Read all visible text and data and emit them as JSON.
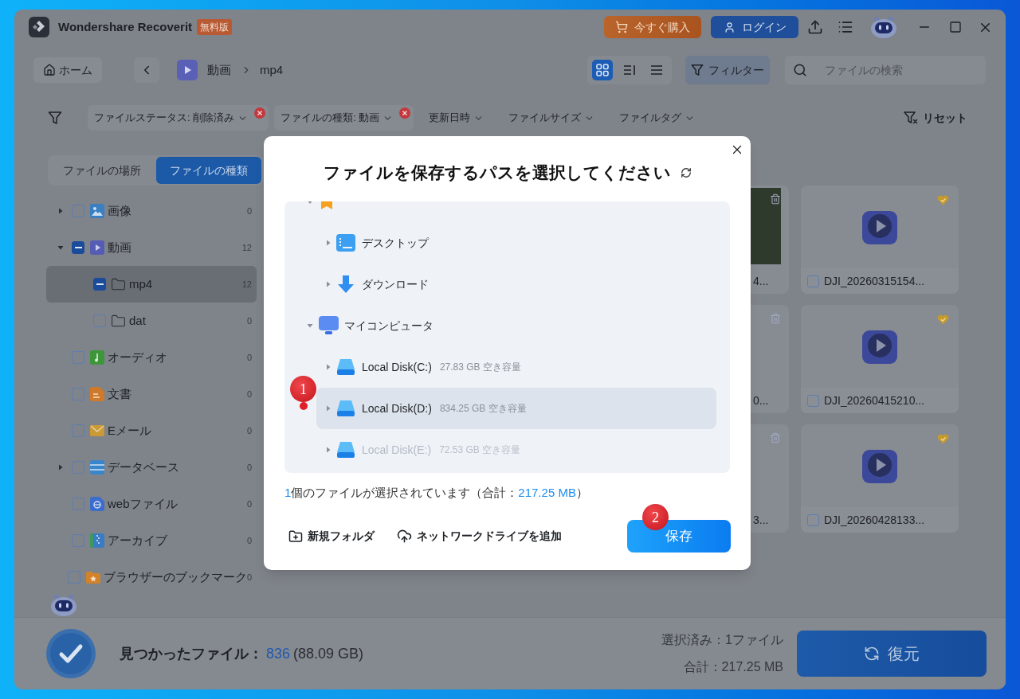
{
  "window": {
    "app_name": "Wondershare Recoverit",
    "edition_badge": "無料版",
    "buy_button": "今すぐ購入",
    "login_button": "ログイン"
  },
  "toolbar": {
    "home_button": "ホーム",
    "breadcrumb": [
      {
        "label": "動画"
      },
      {
        "label": "mp4"
      }
    ],
    "view_modes": [
      {
        "kind": "grid",
        "selected": true
      },
      {
        "kind": "detail",
        "selected": false
      },
      {
        "kind": "list",
        "selected": false
      }
    ],
    "filter_button": {
      "label": "フィルター",
      "active": true
    },
    "search": {
      "placeholder": "ファイルの検索"
    }
  },
  "filters": {
    "items": [
      {
        "label": "ファイルステータス: 削除済み",
        "active": true
      },
      {
        "label": "ファイルの種類: 動画",
        "active": true
      },
      {
        "label": "更新日時",
        "active": false
      },
      {
        "label": "ファイルサイズ",
        "active": false
      },
      {
        "label": "ファイルタグ",
        "active": false
      }
    ],
    "reset": "リセット"
  },
  "sidebar": {
    "tabs": [
      {
        "label": "ファイルの場所",
        "selected": false
      },
      {
        "label": "ファイルの種類",
        "selected": true
      }
    ],
    "categories": [
      {
        "label": "画像",
        "count": "0",
        "kind": "image",
        "expandable": true,
        "expanded": false,
        "checked": false,
        "indeterminate": false,
        "selected": false
      },
      {
        "label": "動画",
        "count": "12",
        "kind": "video",
        "expandable": true,
        "expanded": true,
        "checked": true,
        "indeterminate": true,
        "selected": false,
        "children": [
          {
            "label": "mp4",
            "count": "12",
            "kind": "folder",
            "expandable": false,
            "expanded": false,
            "checked": true,
            "indeterminate": true,
            "selected": true
          },
          {
            "label": "dat",
            "count": "0",
            "kind": "folder",
            "expandable": false,
            "expanded": false,
            "checked": false,
            "indeterminate": false,
            "selected": false
          }
        ]
      },
      {
        "label": "オーディオ",
        "count": "0",
        "kind": "audio",
        "expandable": false,
        "expanded": false,
        "checked": false,
        "indeterminate": false,
        "selected": false
      },
      {
        "label": "文書",
        "count": "0",
        "kind": "document",
        "expandable": false,
        "expanded": false,
        "checked": false,
        "indeterminate": false,
        "selected": false
      },
      {
        "label": "Eメール",
        "count": "0",
        "kind": "email",
        "expandable": false,
        "expanded": false,
        "checked": false,
        "indeterminate": false,
        "selected": false
      },
      {
        "label": "データベース",
        "count": "0",
        "kind": "database",
        "expandable": true,
        "expanded": false,
        "checked": false,
        "indeterminate": false,
        "selected": false
      },
      {
        "label": "webファイル",
        "count": "0",
        "kind": "web",
        "expandable": false,
        "expanded": false,
        "checked": false,
        "indeterminate": false,
        "selected": false
      },
      {
        "label": "アーカイブ",
        "count": "0",
        "kind": "archive",
        "expandable": false,
        "expanded": false,
        "checked": false,
        "indeterminate": false,
        "selected": false
      },
      {
        "label": "ブラウザーのブックマーク",
        "count": "0",
        "kind": "bookmark",
        "expandable": false,
        "expanded": false,
        "checked": false,
        "indeterminate": false,
        "selected": false
      }
    ]
  },
  "file_grid": {
    "rows": [
      {
        "covered_card": {
          "name": "4...",
          "kind": "photo",
          "deleted": true,
          "favorite": false
        },
        "card": {
          "name": "DJI_20260315154...",
          "kind": "video",
          "deleted": false,
          "favorite": true,
          "checked": false
        }
      },
      {
        "covered_card": {
          "name": "0...",
          "kind": "video",
          "deleted": true,
          "favorite": false
        },
        "card": {
          "name": "DJI_20260415210...",
          "kind": "video",
          "deleted": false,
          "favorite": true,
          "checked": false
        }
      },
      {
        "covered_card": {
          "name": "3...",
          "kind": "video",
          "deleted": true,
          "favorite": false
        },
        "card": {
          "name": "DJI_20260428133...",
          "kind": "video",
          "deleted": false,
          "favorite": true,
          "checked": false
        }
      }
    ]
  },
  "save_dialog": {
    "title": "ファイルを保存するパスを選択してください",
    "tree": [
      {
        "kind": "bookmark",
        "expanded": true,
        "selected": false,
        "children": [
          {
            "label": "デスクトップ",
            "kind": "desktop",
            "expanded": false,
            "selected": false
          },
          {
            "label": "ダウンロード",
            "kind": "download",
            "expanded": false,
            "selected": false
          }
        ]
      },
      {
        "label": "マイコンピュータ",
        "kind": "computer",
        "expanded": true,
        "selected": false,
        "children": [
          {
            "label": "Local Disk(C:)",
            "free_space": "27.83 GB 空き容量",
            "kind": "disk",
            "expanded": false,
            "selected": false,
            "disabled": false
          },
          {
            "label": "Local Disk(D:)",
            "free_space": "834.25 GB 空き容量",
            "kind": "disk",
            "expanded": false,
            "selected": true,
            "disabled": false
          },
          {
            "label": "Local Disk(E:)",
            "free_space": "72.53 GB 空き容量",
            "kind": "disk",
            "expanded": false,
            "selected": false,
            "disabled": true
          }
        ]
      }
    ],
    "summary": {
      "count": "1",
      "text": "個のファイルが選択されています（合計：",
      "total": "217.25 MB",
      "close": "）"
    },
    "new_folder": "新規フォルダ",
    "add_network_drive": "ネットワークドライブを追加",
    "save_button": "保存"
  },
  "status_bar": {
    "found_label": "見つかったファイル：",
    "found_count": "836",
    "found_size": "(88.09 GB)",
    "selected": "選択済み：1ファイル",
    "total": "合計：217.25 MB",
    "restore_button": "復元"
  },
  "step_markers": [
    {
      "label": "1",
      "kind": "pin"
    },
    {
      "label": "2",
      "kind": "badge"
    }
  ]
}
